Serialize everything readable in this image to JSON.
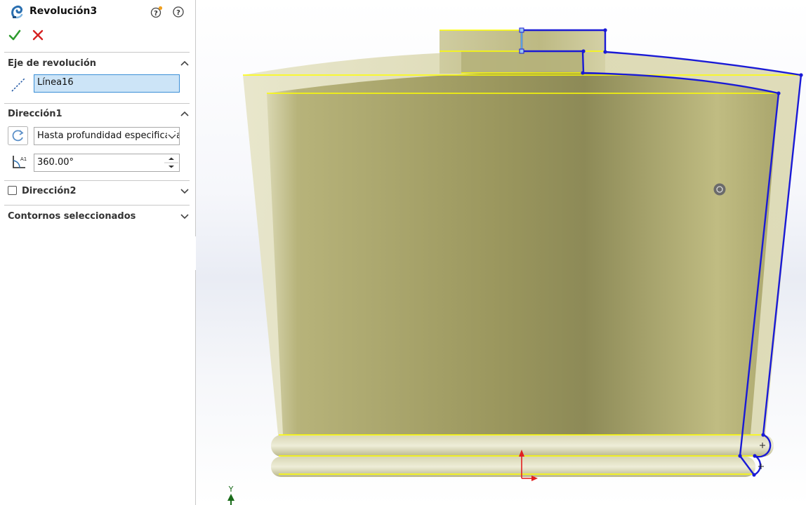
{
  "feature": {
    "title": "Revolución3",
    "icon": "revolve-feature-icon"
  },
  "header_icons": [
    "whats-new-help-icon",
    "help-icon"
  ],
  "actions": {
    "ok_icon": "checkmark-icon",
    "cancel_icon": "x-icon"
  },
  "sections": {
    "axis": {
      "title": "Eje de revolución",
      "value": "Línea16",
      "icon": "axis-line-icon"
    },
    "direction1": {
      "title": "Dirección1",
      "end_condition": "Hasta profundidad especificada",
      "angle": "360.00°",
      "reverse_icon": "reverse-direction-icon",
      "angle_icon": "angle-icon"
    },
    "direction2": {
      "title": "Dirección2",
      "checked": false
    },
    "selected_contours": {
      "title": "Contornos seleccionados"
    }
  },
  "triad": {
    "y_label": "Y"
  },
  "colors": {
    "body": "#b3ae6b",
    "profile": "#1a1ad6",
    "edge_highlight": "#ffff00",
    "ok": "#2e9b2e",
    "cancel": "#d62222",
    "selection": "#cce4f7"
  }
}
